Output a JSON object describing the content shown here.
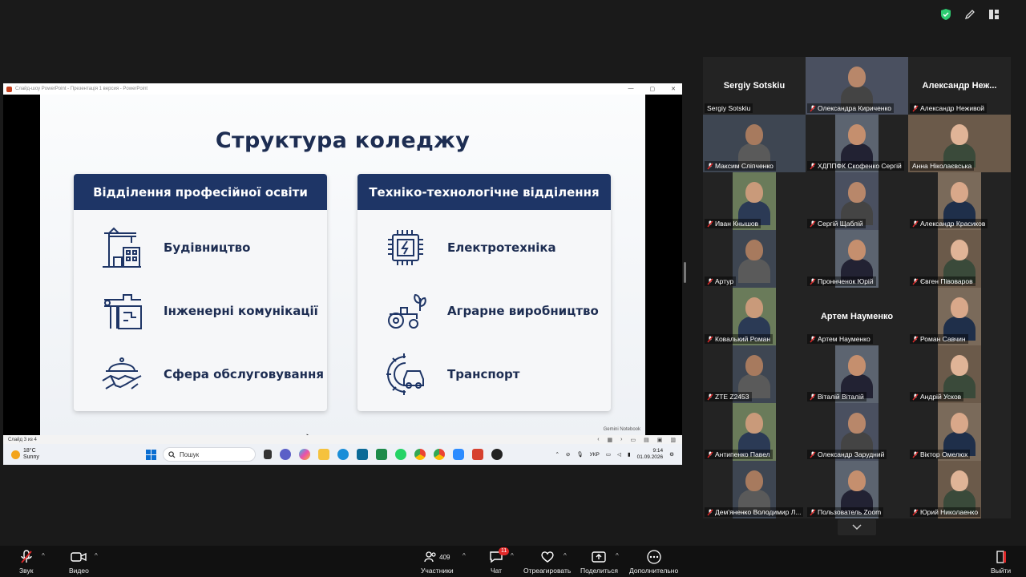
{
  "powerpoint": {
    "title_bar": "Слайд-шоу PowerPoint  -  Презентація 1 версия - PowerPoint",
    "status_left": "Слайд 3 из 4",
    "watermark": "Gemini Notebook"
  },
  "slide": {
    "title": "Структура коледжу",
    "cards": [
      {
        "header": "Відділення професійної освіти",
        "items": [
          {
            "label": "Будівництво",
            "icon": "construction-icon"
          },
          {
            "label": "Інженерні комунікації",
            "icon": "pipes-icon"
          },
          {
            "label": "Сфера обслуговування",
            "icon": "service-icon"
          }
        ]
      },
      {
        "header": "Техніко-технологічне відділення",
        "items": [
          {
            "label": "Електротехніка",
            "icon": "chip-icon"
          },
          {
            "label": "Аграрне виробництво",
            "icon": "tractor-icon"
          },
          {
            "label": "Транспорт",
            "icon": "car-gear-icon"
          }
        ]
      }
    ]
  },
  "taskbar": {
    "weather_temp": "18°C",
    "weather_desc": "Sunny",
    "search_placeholder": "Пошук",
    "lang": "УКР",
    "time": "9:14",
    "date": "01.09.2026"
  },
  "participants": [
    {
      "name": "Sergiy Sotskiu",
      "big_name": "Sergiy Sotskiu",
      "muted": false
    },
    {
      "name": "Олександра Кириченко",
      "muted": true
    },
    {
      "name": "Александр Неживой",
      "big_name": "Александр  Неж...",
      "muted": true
    },
    {
      "name": "Максим Сліпченко",
      "muted": true
    },
    {
      "name": "ХДППФК Скофенко Сергій",
      "muted": true
    },
    {
      "name": "Анна Ніколаєвська",
      "muted": false
    },
    {
      "name": "Иван Кнышов",
      "muted": true
    },
    {
      "name": "Сергій Щаблій",
      "muted": true
    },
    {
      "name": "Александр Красиков",
      "muted": true
    },
    {
      "name": "Артур",
      "muted": true
    },
    {
      "name": "Проннченок Юрій",
      "muted": true
    },
    {
      "name": "Євген Півоваров",
      "muted": true
    },
    {
      "name": "Ковалький Роман",
      "muted": true
    },
    {
      "name": "Артем Науменко",
      "big_name": "Артем Науменко",
      "muted": true
    },
    {
      "name": "Роман Савчин",
      "muted": true
    },
    {
      "name": "ZTE Z2453",
      "muted": true
    },
    {
      "name": "Віталій Віталій",
      "muted": true
    },
    {
      "name": "Андрій Усков",
      "muted": true
    },
    {
      "name": "Антипенко Павел",
      "muted": true
    },
    {
      "name": "Олександр Зарудний",
      "muted": true
    },
    {
      "name": "Віктор Омелюх",
      "muted": true
    },
    {
      "name": "Дем'яненко Володимир Л...",
      "muted": true
    },
    {
      "name": "Пользователь Zoom",
      "muted": true
    },
    {
      "name": "Юрий Николаенко",
      "muted": true
    }
  ],
  "toolbar": {
    "audio": "Звук",
    "video": "Видео",
    "participants": "Участники",
    "participants_count": "409",
    "chat": "Чат",
    "chat_badge": "11",
    "react": "Отреагировать",
    "share": "Поделиться",
    "more": "Дополнительно",
    "leave": "Выйти"
  },
  "colors": {
    "slide_navy": "#1e3566",
    "active_border": "#4caf50",
    "muted_red": "#e02828"
  }
}
